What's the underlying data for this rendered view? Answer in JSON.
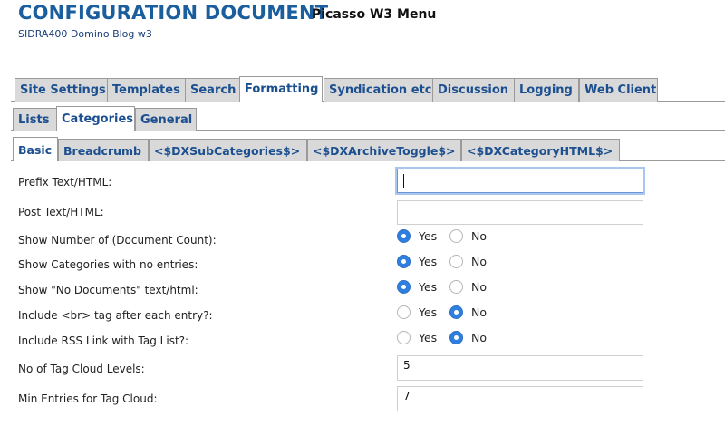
{
  "header": {
    "title": "CONFIGURATION DOCUMENT",
    "menu_name": "Picasso W3 Menu",
    "subtitle": "SIDRA400  Domino Blog w3"
  },
  "tabs_primary": [
    {
      "label": "Site Settings",
      "active": false
    },
    {
      "label": "Templates",
      "active": false
    },
    {
      "label": "Search",
      "active": false
    },
    {
      "label": "Formatting",
      "active": true
    },
    {
      "label": "Syndication etc",
      "active": false
    },
    {
      "label": "Discussion",
      "active": false
    },
    {
      "label": "Logging",
      "active": false
    },
    {
      "label": "Web Client",
      "active": false
    }
  ],
  "tabs_secondary": [
    {
      "label": "Lists",
      "active": false
    },
    {
      "label": "Categories",
      "active": true
    },
    {
      "label": "General",
      "active": false
    }
  ],
  "tabs_tertiary": [
    {
      "label": "Basic",
      "active": true
    },
    {
      "label": "Breadcrumb",
      "active": false
    },
    {
      "label": "<$DXSubCategories$>",
      "active": false
    },
    {
      "label": "<$DXArchiveToggle$>",
      "active": false
    },
    {
      "label": "<$DXCategoryHTML$>",
      "active": false
    }
  ],
  "form": {
    "prefix_label": "Prefix Text/HTML:",
    "prefix_value": "",
    "post_label": "Post Text/HTML:",
    "post_value": "",
    "radio_yes": "Yes",
    "radio_no": "No",
    "show_count_label": "Show Number of (Document Count):",
    "show_count_value": "Yes",
    "show_empty_label": "Show Categories with no entries:",
    "show_empty_value": "Yes",
    "show_nodocs_label": "Show \"No Documents\" text/html:",
    "show_nodocs_value": "Yes",
    "include_br_label": "Include <br> tag after each entry?:",
    "include_br_value": "No",
    "include_rss_label": "Include RSS Link with Tag List?:",
    "include_rss_value": "No",
    "cloud_levels_label": "No of Tag Cloud Levels:",
    "cloud_levels_value": "5",
    "min_entries_label": "Min Entries for Tag Cloud:",
    "min_entries_value": "7"
  }
}
